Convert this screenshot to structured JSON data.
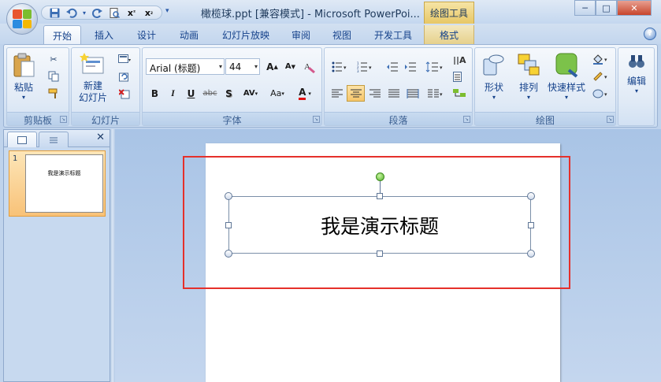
{
  "window": {
    "title": "橄榄球.ppt [兼容模式] - Microsoft PowerPoi...",
    "context_tab_group": "绘图工具",
    "controls": {
      "minimize": "─",
      "maximize": "□",
      "close": "✕"
    }
  },
  "quick_access": {
    "icons": [
      "save-icon",
      "undo-icon",
      "redo-icon",
      "print-preview-icon",
      "x-superscript-icon",
      "x-subscript-icon",
      "customize-dropdown-icon"
    ]
  },
  "tabs": [
    {
      "label": "开始",
      "active": true
    },
    {
      "label": "插入"
    },
    {
      "label": "设计"
    },
    {
      "label": "动画"
    },
    {
      "label": "幻灯片放映"
    },
    {
      "label": "审阅"
    },
    {
      "label": "视图"
    },
    {
      "label": "开发工具"
    },
    {
      "label": "格式",
      "contextual": true
    }
  ],
  "help_glyph": "?",
  "ribbon": {
    "clipboard": {
      "group_label": "剪贴板",
      "paste_label": "粘贴"
    },
    "slides": {
      "group_label": "幻灯片",
      "new_slide_label": "新建\n幻灯片"
    },
    "font": {
      "group_label": "字体",
      "font_name": "Arial (标题)",
      "font_size": "44",
      "bold": "B",
      "italic": "I",
      "underline": "U",
      "strike": "abc",
      "shadow": "S",
      "spacing": "AV",
      "case": "Aa",
      "color": "A",
      "grow": "A",
      "shrink": "A"
    },
    "paragraph": {
      "group_label": "段落"
    },
    "drawing": {
      "group_label": "绘图",
      "shapes_label": "形状",
      "arrange_label": "排列",
      "quick_styles_label": "快速样式"
    },
    "editing": {
      "group_label": "编辑"
    },
    "accent_active": "#f7c66a"
  },
  "slides_pane": {
    "close_glyph": "✕",
    "slides": [
      {
        "number": "1",
        "thumbnail_text": "我是演示标题"
      }
    ]
  },
  "slide": {
    "title_text": "我是演示标题"
  },
  "annotation": {
    "color": "#e5302b"
  }
}
